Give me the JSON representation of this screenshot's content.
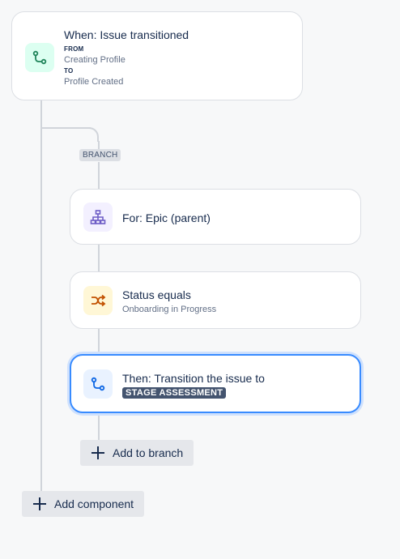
{
  "trigger": {
    "title": "When: Issue transitioned",
    "from_label": "FROM",
    "from_value": "Creating Profile",
    "to_label": "TO",
    "to_value": "Profile Created",
    "icon": "transition-icon"
  },
  "branch": {
    "tag": "BRANCH",
    "for_card": {
      "title": "For: Epic (parent)",
      "icon": "hierarchy-icon"
    },
    "condition_card": {
      "title": "Status equals",
      "value": "Onboarding in Progress",
      "icon": "shuffle-icon"
    },
    "action_card": {
      "title": "Then: Transition the issue to",
      "status": "STAGE ASSESSMENT",
      "icon": "transition-icon"
    },
    "add_button": "Add to branch"
  },
  "add_component_button": "Add component",
  "colors": {
    "trigger_icon_bg": "#dcfff1",
    "trigger_icon": "#1f845a",
    "for_icon_bg": "#f3f0ff",
    "for_icon": "#6e5dc6",
    "condition_icon_bg": "#fff7d6",
    "condition_icon": "#c25100",
    "action_icon_bg": "#e9f2ff",
    "action_icon": "#0c66e4",
    "selected_border": "#388bff"
  }
}
